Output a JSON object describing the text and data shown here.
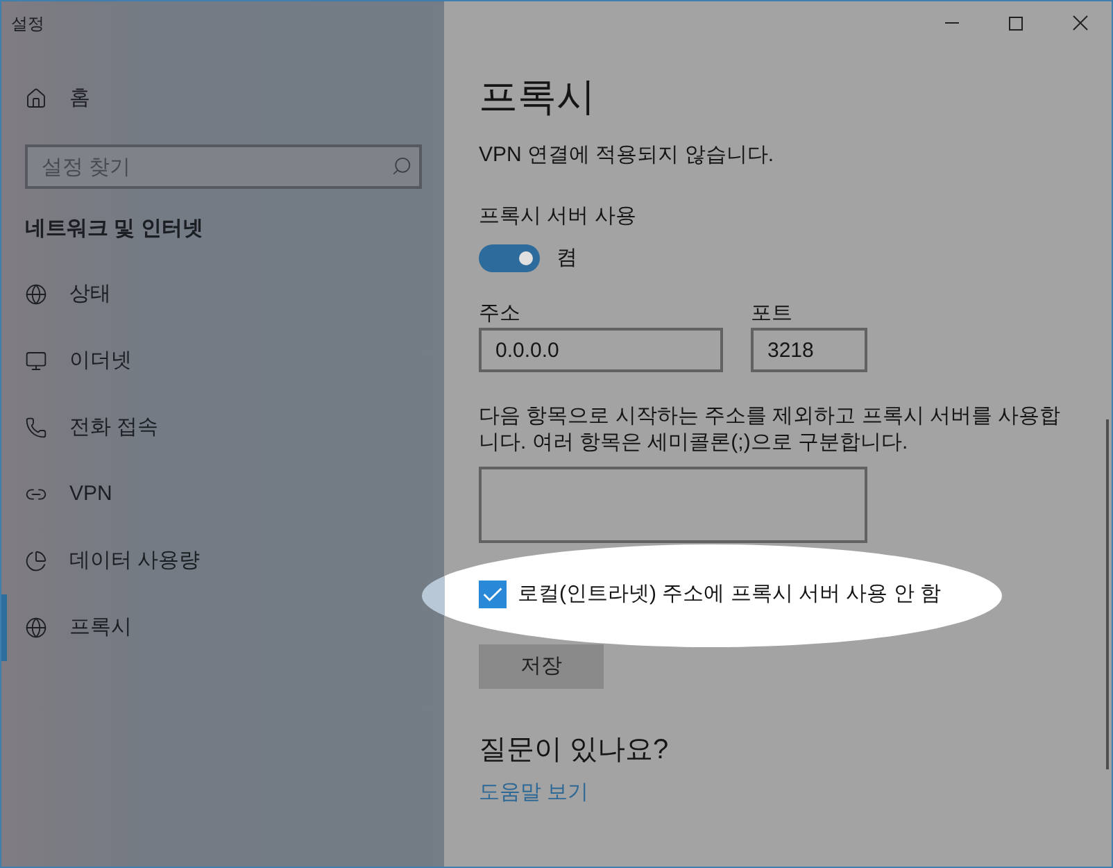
{
  "window": {
    "title": "설정"
  },
  "sidebar": {
    "home": "홈",
    "search": {
      "placeholder": "설정 찾기"
    },
    "section_title": "네트워크 및 인터넷",
    "items": [
      {
        "label": "상태",
        "selected": false
      },
      {
        "label": "이더넷",
        "selected": false
      },
      {
        "label": "전화 접속",
        "selected": false
      },
      {
        "label": "VPN",
        "selected": false
      },
      {
        "label": "데이터 사용량",
        "selected": false
      },
      {
        "label": "프록시",
        "selected": true
      }
    ]
  },
  "page": {
    "title": "프록시",
    "intro_tail": "VPN 연결에 적용되지 않습니다.",
    "proxy_server": {
      "label": "프록시 서버 사용",
      "toggle": {
        "on": true,
        "state_label": "켬"
      }
    },
    "address": {
      "label": "주소",
      "value": "0.0.0.0"
    },
    "port": {
      "label": "포트",
      "value": "3218"
    },
    "exceptions": {
      "description": "다음 항목으로 시작하는 주소를 제외하고 프록시 서버를 사용합니다. 여러 항목은 세미콜론(;)으로 구분합니다."
    },
    "bypass_local": {
      "label": "로컬(인트라넷) 주소에 프록시 서버 사용 안 함",
      "checked": true,
      "highlighted": true
    },
    "save_button": "저장",
    "help": {
      "title": "질문이 있나요?",
      "link": "도움말 보기"
    }
  }
}
